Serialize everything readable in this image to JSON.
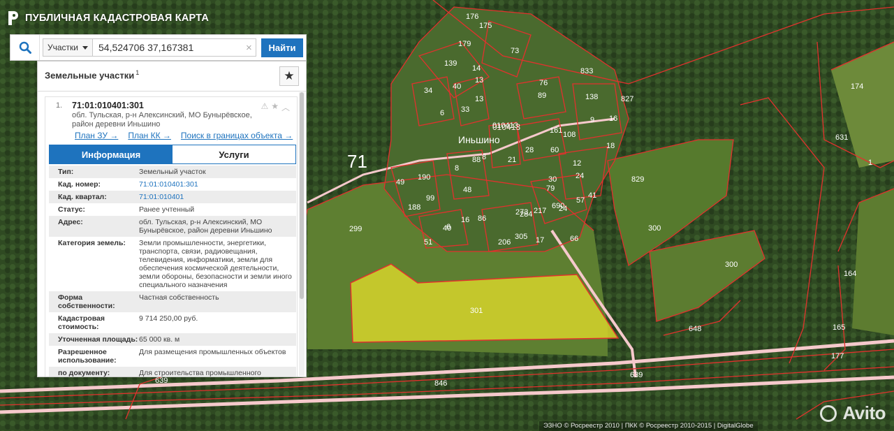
{
  "app": {
    "title": "ПУБЛИЧНАЯ КАДАСТРОВАЯ КАРТА"
  },
  "search": {
    "type_selected": "Участки",
    "value": "54,524706 37,167381",
    "clear_icon": "×",
    "button_label": "Найти",
    "search_icon": "search-icon"
  },
  "panel": {
    "title": "Земельные участки",
    "count": "1",
    "favorite_icon": "★",
    "item": {
      "index": "1.",
      "cad_number": "71:01:010401:301",
      "address": "обл. Тульская, р-н Алексинский, МО Бунырёвское, район деревни Иньшино",
      "icons": [
        "⚠",
        "★",
        "︿"
      ],
      "links": [
        "План ЗУ →",
        "План КК →",
        "Поиск в границах объекта →"
      ],
      "tabs": [
        "Информация",
        "Услуги"
      ],
      "info": [
        {
          "k": "Тип:",
          "v": "Земельный участок"
        },
        {
          "k": "Кад. номер:",
          "v": "71:01:010401:301"
        },
        {
          "k": "Кад. квартал:",
          "v": "71:01:010401"
        },
        {
          "k": "Статус:",
          "v": "Ранее учтенный"
        },
        {
          "k": "Адрес:",
          "v": "обл. Тульская, р-н Алексинский, МО Бунырёвское, район деревни Иньшино"
        },
        {
          "k": "Категория земель:",
          "v": "Земли промышленности, энергетики, транспорта, связи, радиовещания, телевидения, информатики, земли для обеспечения космической деятельности, земли обороны, безопасности и земли иного специального назначения"
        },
        {
          "k": "Форма собственности:",
          "v": "Частная собственность"
        },
        {
          "k": "Кадастровая стоимость:",
          "v": "9 714 250,00 руб."
        },
        {
          "k": "Уточненная площадь:",
          "v": "65 000 кв. м"
        },
        {
          "k": "Разрешенное использование:",
          "v": "Для размещения промышленных объектов"
        },
        {
          "k": "по документу:",
          "v": "Для строительства промышленного"
        }
      ]
    }
  },
  "map": {
    "region_label": "71",
    "kvartal_label": "010413",
    "place_label": "Иньшино",
    "selected_parcel_label": "301",
    "parcel_labels": [
      "176",
      "175",
      "179",
      "73",
      "139",
      "14",
      "40",
      "13",
      "34",
      "33",
      "13",
      "6",
      "76",
      "89",
      "833",
      "138",
      "827",
      "174",
      "631",
      "16",
      "9",
      "18",
      "010413",
      "161",
      "108",
      "24",
      "30",
      "21",
      "28",
      "60",
      "12",
      "829",
      "8",
      "8",
      "48",
      "88",
      "49",
      "190",
      "99",
      "188",
      "273",
      "79",
      "86",
      "6",
      "24",
      "57",
      "41",
      "217",
      "690",
      "284",
      "51",
      "40",
      "16",
      "206",
      "305",
      "17",
      "66",
      "299",
      "300",
      "300",
      "164",
      "648",
      "165",
      "177",
      "639",
      "846",
      "639",
      "1"
    ],
    "copyright": "ЭЗНО © Росреестр 2010 | ПКК © Росреестр 2010-2015 | DigitalGlobe",
    "watermark": "Avito",
    "colors": {
      "parcel_border": "#e2312d",
      "selected_fill": "#d6d42b",
      "road": "#f6c9cc",
      "forest": "#2f4a22",
      "field": "#5e7f31"
    }
  }
}
